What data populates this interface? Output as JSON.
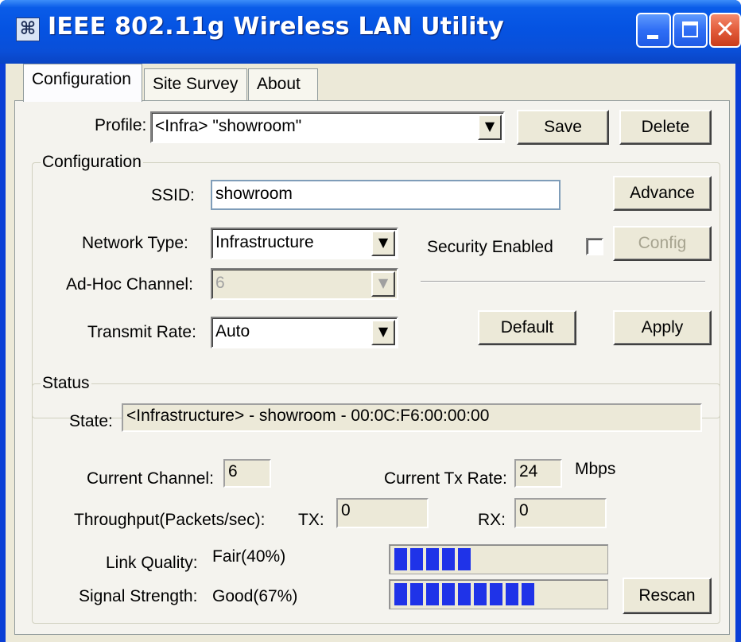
{
  "window": {
    "title": "IEEE 802.11g Wireless LAN Utility",
    "icon": "network-icon"
  },
  "tabs": [
    {
      "label": "Configuration",
      "active": true
    },
    {
      "label": "Site Survey",
      "active": false
    },
    {
      "label": "About",
      "active": false
    }
  ],
  "profile": {
    "label": "Profile:",
    "value": "<Infra> \"showroom\"",
    "save_label": "Save",
    "delete_label": "Delete"
  },
  "configuration": {
    "group_title": "Configuration",
    "ssid_label": "SSID:",
    "ssid_value": "showroom",
    "advance_label": "Advance",
    "network_type_label": "Network Type:",
    "network_type_value": "Infrastructure",
    "security_label": "Security Enabled",
    "security_checked": false,
    "config_label": "Config",
    "adhoc_label": "Ad-Hoc Channel:",
    "adhoc_value": "6",
    "rate_label": "Transmit Rate:",
    "rate_value": "Auto",
    "default_label": "Default",
    "apply_label": "Apply"
  },
  "status": {
    "group_title": "Status",
    "state_label": "State:",
    "state_value": "<Infrastructure> - showroom - 00:0C:F6:00:00:00",
    "channel_label": "Current Channel:",
    "channel_value": "6",
    "txrate_label": "Current Tx Rate:",
    "txrate_value": "24",
    "txrate_unit": "Mbps",
    "throughput_label": "Throughput(Packets/sec):",
    "tx_label": "TX:",
    "tx_value": "0",
    "rx_label": "RX:",
    "rx_value": "0",
    "link_label": "Link Quality:",
    "link_value": "Fair(40%)",
    "link_percent": 40,
    "signal_label": "Signal Strength:",
    "signal_value": "Good(67%)",
    "signal_percent": 67,
    "rescan_label": "Rescan"
  },
  "colors": {
    "titlebar": "#0553e2",
    "progress_fill": "#1f33e8",
    "face": "#ece9d8"
  }
}
